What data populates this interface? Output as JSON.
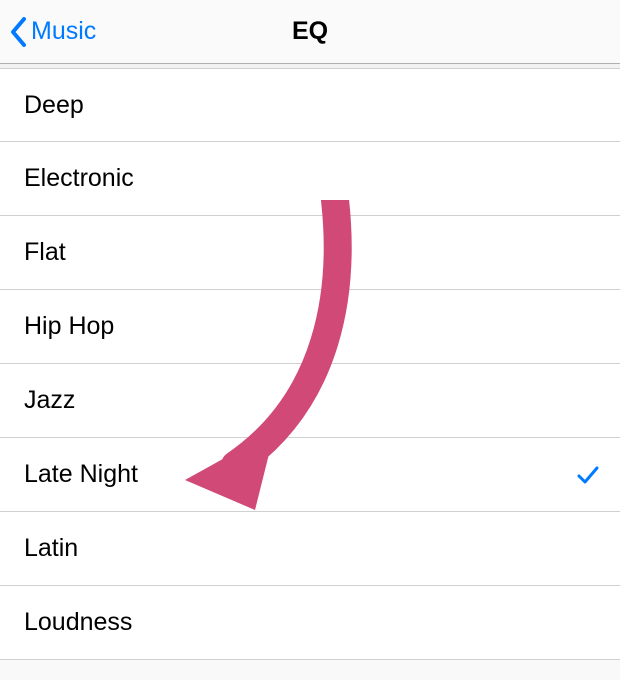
{
  "nav": {
    "back_label": "Music",
    "title": "EQ"
  },
  "eq": {
    "items": [
      {
        "label": "Deep",
        "selected": false
      },
      {
        "label": "Electronic",
        "selected": false
      },
      {
        "label": "Flat",
        "selected": false
      },
      {
        "label": "Hip Hop",
        "selected": false
      },
      {
        "label": "Jazz",
        "selected": false
      },
      {
        "label": "Late Night",
        "selected": true
      },
      {
        "label": "Latin",
        "selected": false
      },
      {
        "label": "Loudness",
        "selected": false
      }
    ]
  },
  "annotation": {
    "arrow_color": "#d14a77",
    "target_item": "Late Night"
  }
}
